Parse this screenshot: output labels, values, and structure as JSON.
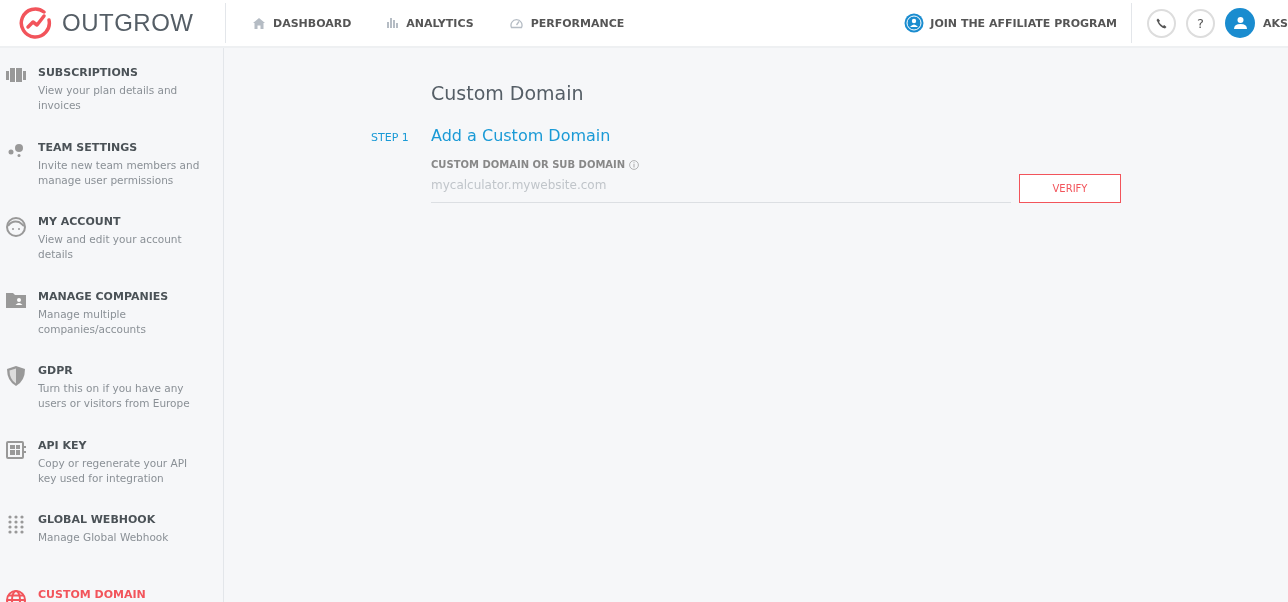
{
  "header": {
    "logo": "OUTGROW",
    "nav": [
      {
        "label": "DASHBOARD",
        "kind": "home"
      },
      {
        "label": "ANALYTICS",
        "kind": "chart"
      },
      {
        "label": "PERFORMANCE",
        "kind": "gauge"
      }
    ],
    "affiliate": "JOIN THE AFFILIATE PROGRAM",
    "help": "?",
    "user": "AKS"
  },
  "sidebar": {
    "items": [
      {
        "title": "SUBSCRIPTIONS",
        "description": "View your plan details and invoices",
        "kind": "subscriptions",
        "selected": false
      },
      {
        "title": "TEAM SETTINGS",
        "description": "Invite new team members and manage user permissions",
        "kind": "team",
        "selected": false
      },
      {
        "title": "MY ACCOUNT",
        "description": "View and edit your account details",
        "kind": "account",
        "selected": false
      },
      {
        "title": "MANAGE COMPANIES",
        "description": "Manage multiple companies/accounts",
        "kind": "companies",
        "selected": false
      },
      {
        "title": "GDPR",
        "description": "Turn this on if you have any users or visitors from Europe",
        "kind": "gdpr",
        "selected": false
      },
      {
        "title": "API KEY",
        "description": "Copy or regenerate your API key used for integration",
        "kind": "api",
        "selected": false
      },
      {
        "title": "GLOBAL WEBHOOK",
        "description": "Manage Global Webhook",
        "kind": "webhook",
        "selected": false
      },
      {
        "title": "CUSTOM DOMAIN",
        "kind": "domain",
        "selected": true
      }
    ]
  },
  "main": {
    "title": "Custom Domain",
    "step_label": "STEP 1",
    "step_title": "Add a Custom Domain",
    "field_label": "CUSTOM DOMAIN OR SUB DOMAIN",
    "placeholder": "mycalculator.mywebsite.com",
    "button": "VERIFY"
  }
}
